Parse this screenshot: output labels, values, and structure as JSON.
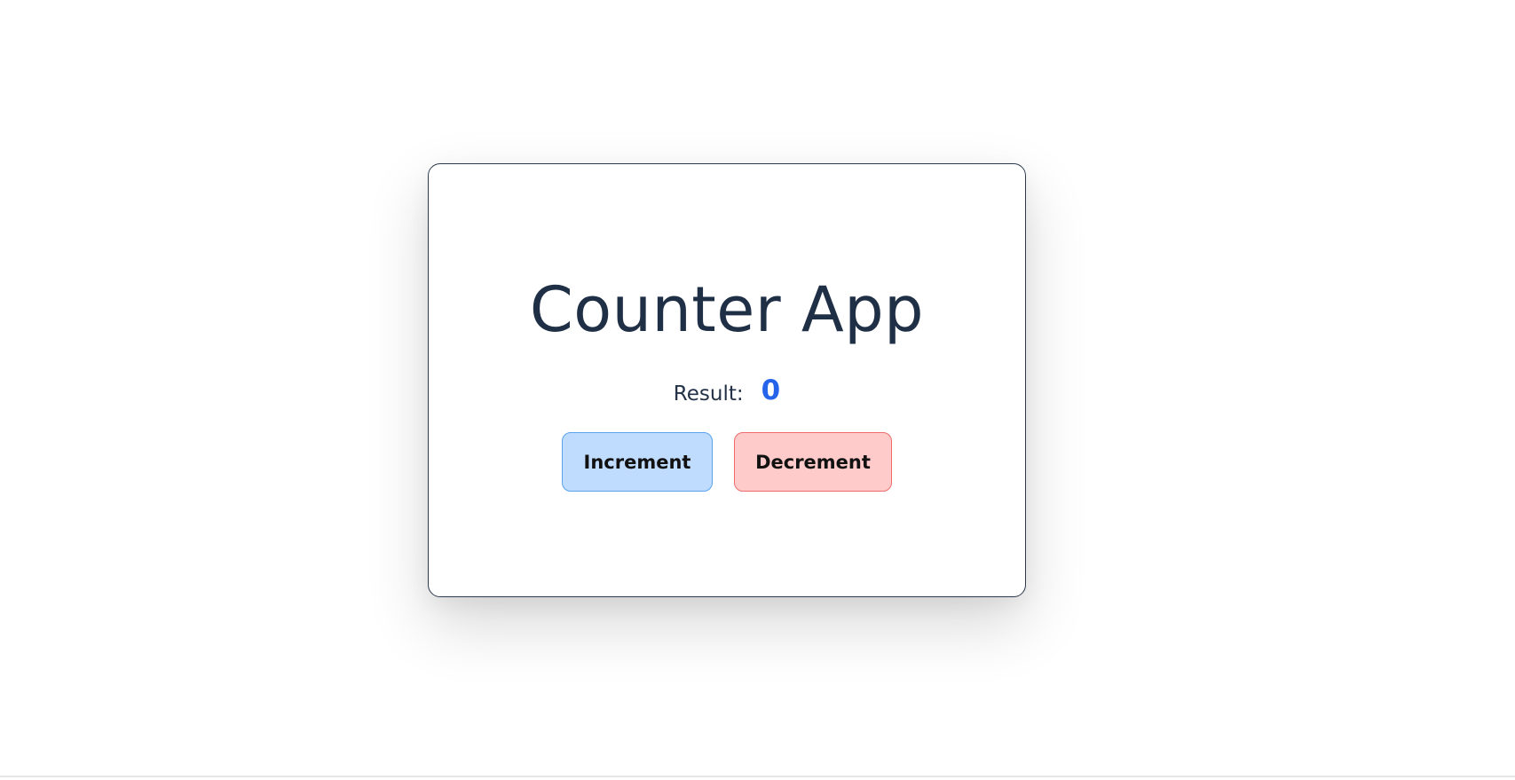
{
  "app": {
    "title": "Counter App",
    "result_label": "Result:",
    "result_value": "0"
  },
  "buttons": {
    "increment_label": "Increment",
    "decrement_label": "Decrement"
  },
  "colors": {
    "title_text": "#1f2f45",
    "result_value": "#2563eb",
    "increment_bg": "#bfdbfe",
    "increment_border": "#5aa3ee",
    "decrement_bg": "#fecaca",
    "decrement_border": "#ef6b6b"
  }
}
